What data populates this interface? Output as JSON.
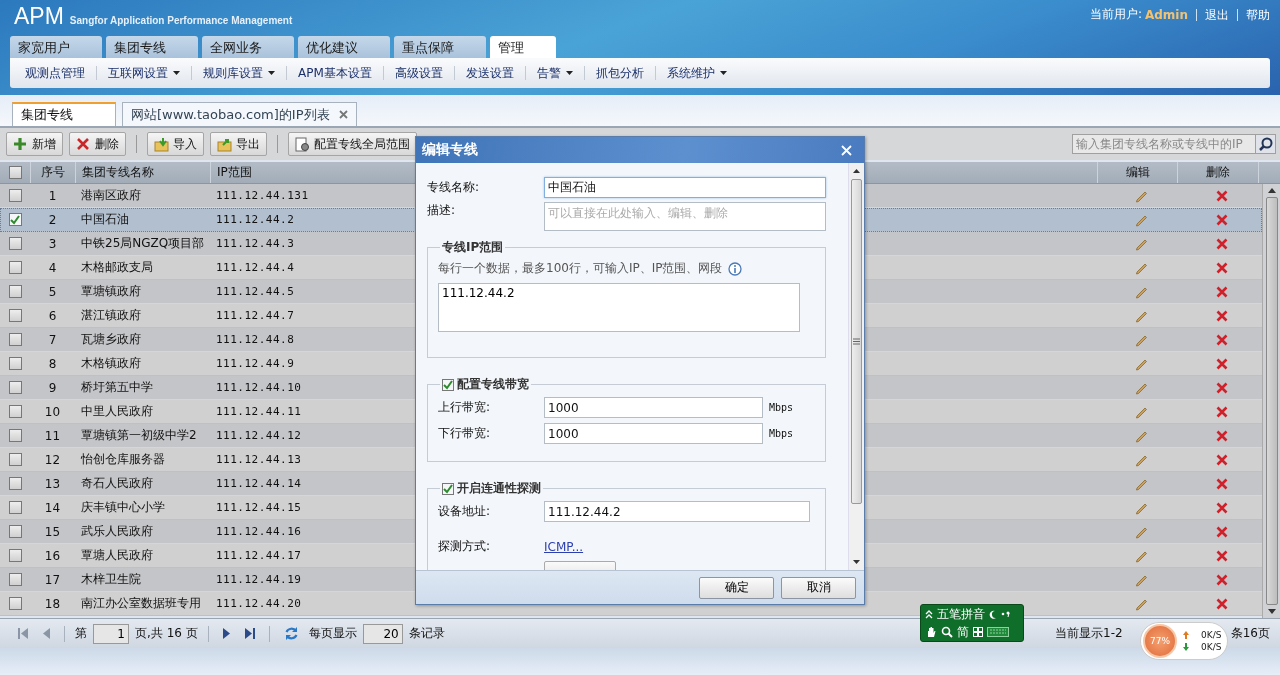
{
  "header": {
    "logo": "APM",
    "subtitle": "Sangfor Application Performance Management",
    "user_label": "当前用户:",
    "user": "Admin",
    "links": [
      "退出",
      "帮助"
    ]
  },
  "main_tabs": [
    {
      "label": "家宽用户",
      "selected": false
    },
    {
      "label": "集团专线",
      "selected": false
    },
    {
      "label": "全网业务",
      "selected": false
    },
    {
      "label": "优化建议",
      "selected": false
    },
    {
      "label": "重点保障",
      "selected": false
    },
    {
      "label": "管理",
      "selected": true
    }
  ],
  "submenu": [
    {
      "label": "观测点管理",
      "dropdown": false
    },
    {
      "label": "互联网设置",
      "dropdown": true
    },
    {
      "label": "规则库设置",
      "dropdown": true
    },
    {
      "label": "APM基本设置",
      "dropdown": false
    },
    {
      "label": "高级设置",
      "dropdown": false
    },
    {
      "label": "发送设置",
      "dropdown": false
    },
    {
      "label": "告警",
      "dropdown": true
    },
    {
      "label": "抓包分析",
      "dropdown": false
    },
    {
      "label": "系统维护",
      "dropdown": true
    }
  ],
  "doc_tabs": [
    {
      "label": "集团专线",
      "selected": true,
      "closable": false
    },
    {
      "label": "网站[www.taobao.com]的IP列表",
      "selected": false,
      "closable": true
    }
  ],
  "toolbar": {
    "groups": [
      [
        {
          "label": "新增",
          "kind": "add"
        },
        {
          "label": "删除",
          "kind": "delete"
        }
      ],
      [
        {
          "label": "导入",
          "kind": "import"
        },
        {
          "label": "导出",
          "kind": "export"
        }
      ],
      [
        {
          "label": "配置专线全局范围",
          "kind": "config"
        }
      ]
    ],
    "search": {
      "placeholder": "输入集团专线名称或专线中的IP"
    }
  },
  "table": {
    "select_all": false,
    "columns": [
      "序号",
      "集团专线名称",
      "IP范围",
      "编辑",
      "删除"
    ],
    "rows": [
      {
        "no": "1",
        "name": "港南区政府",
        "ip": "111.12.44.131",
        "checked": false,
        "selected": false
      },
      {
        "no": "2",
        "name": "中国石油",
        "ip": "111.12.44.2",
        "checked": true,
        "selected": true
      },
      {
        "no": "3",
        "name": "中铁25局NGZQ项目部",
        "ip": "111.12.44.3",
        "checked": false,
        "selected": false
      },
      {
        "no": "4",
        "name": "木格邮政支局",
        "ip": "111.12.44.4",
        "checked": false,
        "selected": false
      },
      {
        "no": "5",
        "name": "覃塘镇政府",
        "ip": "111.12.44.5",
        "checked": false,
        "selected": false
      },
      {
        "no": "6",
        "name": "湛江镇政府",
        "ip": "111.12.44.7",
        "checked": false,
        "selected": false
      },
      {
        "no": "7",
        "name": "瓦塘乡政府",
        "ip": "111.12.44.8",
        "checked": false,
        "selected": false
      },
      {
        "no": "8",
        "name": "木格镇政府",
        "ip": "111.12.44.9",
        "checked": false,
        "selected": false
      },
      {
        "no": "9",
        "name": "桥圩第五中学",
        "ip": "111.12.44.10",
        "checked": false,
        "selected": false
      },
      {
        "no": "10",
        "name": "中里人民政府",
        "ip": "111.12.44.11",
        "checked": false,
        "selected": false
      },
      {
        "no": "11",
        "name": "覃塘镇第一初级中学2",
        "ip": "111.12.44.12",
        "checked": false,
        "selected": false
      },
      {
        "no": "12",
        "name": "怡创仓库服务器",
        "ip": "111.12.44.13",
        "checked": false,
        "selected": false
      },
      {
        "no": "13",
        "name": "奇石人民政府",
        "ip": "111.12.44.14",
        "checked": false,
        "selected": false
      },
      {
        "no": "14",
        "name": "庆丰镇中心小学",
        "ip": "111.12.44.15",
        "checked": false,
        "selected": false
      },
      {
        "no": "15",
        "name": "武乐人民政府",
        "ip": "111.12.44.16",
        "checked": false,
        "selected": false
      },
      {
        "no": "16",
        "name": "覃塘人民政府",
        "ip": "111.12.44.17",
        "checked": false,
        "selected": false
      },
      {
        "no": "17",
        "name": "木梓卫生院",
        "ip": "111.12.44.19",
        "checked": false,
        "selected": false
      },
      {
        "no": "18",
        "name": "南江办公室数据班专用",
        "ip": "111.12.44.20",
        "checked": false,
        "selected": false
      }
    ]
  },
  "pager": {
    "page_label": "第",
    "page": "1",
    "page_total": "页,共 16 页",
    "per_page_label": "每页显示",
    "per_page": "20",
    "records_label": "条记录",
    "status": "当前显示1-2",
    "status_tail": "条16页"
  },
  "dialog": {
    "title": "编辑专线",
    "name_label": "专线名称:",
    "name_value": "中国石油",
    "desc_label": "描述:",
    "desc_placeholder": "可以直接在此处输入、编辑、删除",
    "ip_section": {
      "legend": "专线IP范围",
      "hint": "每行一个数据，最多100行，可输入IP、IP范围、网段",
      "value": "111.12.44.2"
    },
    "bandwidth": {
      "legend": "配置专线带宽",
      "checked": true,
      "fields": [
        {
          "label": "上行带宽:",
          "value": "1000",
          "unit": "Mbps"
        },
        {
          "label": "下行带宽:",
          "value": "1000",
          "unit": "Mbps"
        }
      ]
    },
    "probe": {
      "legend": "开启连通性探测",
      "checked": true,
      "address_label": "设备地址:",
      "address": "111.12.44.2",
      "method_label": "探测方式:",
      "method": "ICMP..."
    },
    "buttons": [
      "确定",
      "取消"
    ]
  },
  "ime": {
    "name": "五笔拼音",
    "mode": "简"
  },
  "net_meter": {
    "percent": "77%",
    "up": "0K/S",
    "down": "0K/S"
  }
}
